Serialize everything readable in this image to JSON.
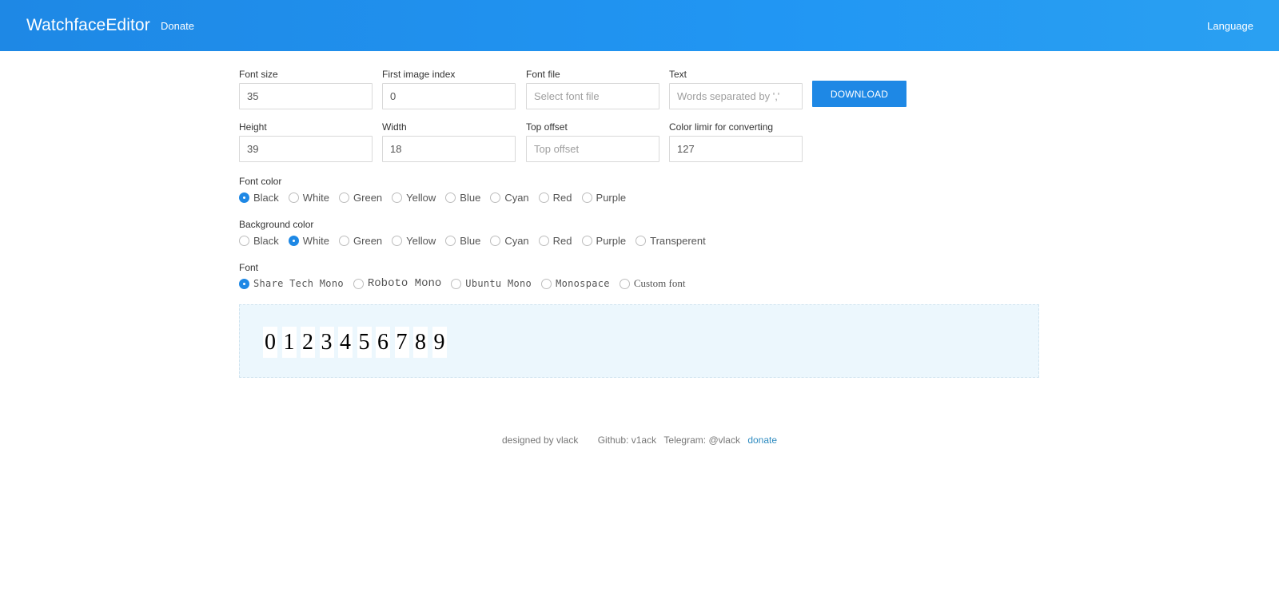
{
  "navbar": {
    "brand": "WatchfaceEditor",
    "donate": "Donate",
    "language": "Language"
  },
  "fields": {
    "font_size": {
      "label": "Font size",
      "value": "35",
      "placeholder": ""
    },
    "first_image_index": {
      "label": "First image index",
      "value": "0",
      "placeholder": ""
    },
    "font_file": {
      "label": "Font file",
      "value": "",
      "placeholder": "Select font file"
    },
    "text": {
      "label": "Text",
      "value": "",
      "placeholder": "Words separated by ','"
    },
    "height": {
      "label": "Height",
      "value": "39",
      "placeholder": ""
    },
    "width": {
      "label": "Width",
      "value": "18",
      "placeholder": ""
    },
    "top_offset": {
      "label": "Top offset",
      "value": "",
      "placeholder": "Top offset"
    },
    "color_limit": {
      "label": "Color limir for converting",
      "value": "127",
      "placeholder": ""
    }
  },
  "download_label": "DOWNLOAD",
  "font_color": {
    "label": "Font color",
    "options": [
      "Black",
      "White",
      "Green",
      "Yellow",
      "Blue",
      "Cyan",
      "Red",
      "Purple"
    ],
    "selected": "Black"
  },
  "background_color": {
    "label": "Background color",
    "options": [
      "Black",
      "White",
      "Green",
      "Yellow",
      "Blue",
      "Cyan",
      "Red",
      "Purple",
      "Transperent"
    ],
    "selected": "White"
  },
  "font": {
    "label": "Font",
    "options": [
      "Share Tech Mono",
      "Roboto Mono",
      "Ubuntu Mono",
      "Monospace",
      "Custom font"
    ],
    "selected": "Share Tech Mono"
  },
  "preview": {
    "digits": [
      "0",
      "1",
      "2",
      "3",
      "4",
      "5",
      "6",
      "7",
      "8",
      "9"
    ]
  },
  "footer": {
    "designed_by": "designed by vlack",
    "github": "Github: v1ack",
    "telegram": "Telegram: @vlack",
    "donate": "donate"
  },
  "colors": {
    "accent": "#1e88e5",
    "preview_bg": "#ecf7fd",
    "link": "#2e8bc0"
  }
}
